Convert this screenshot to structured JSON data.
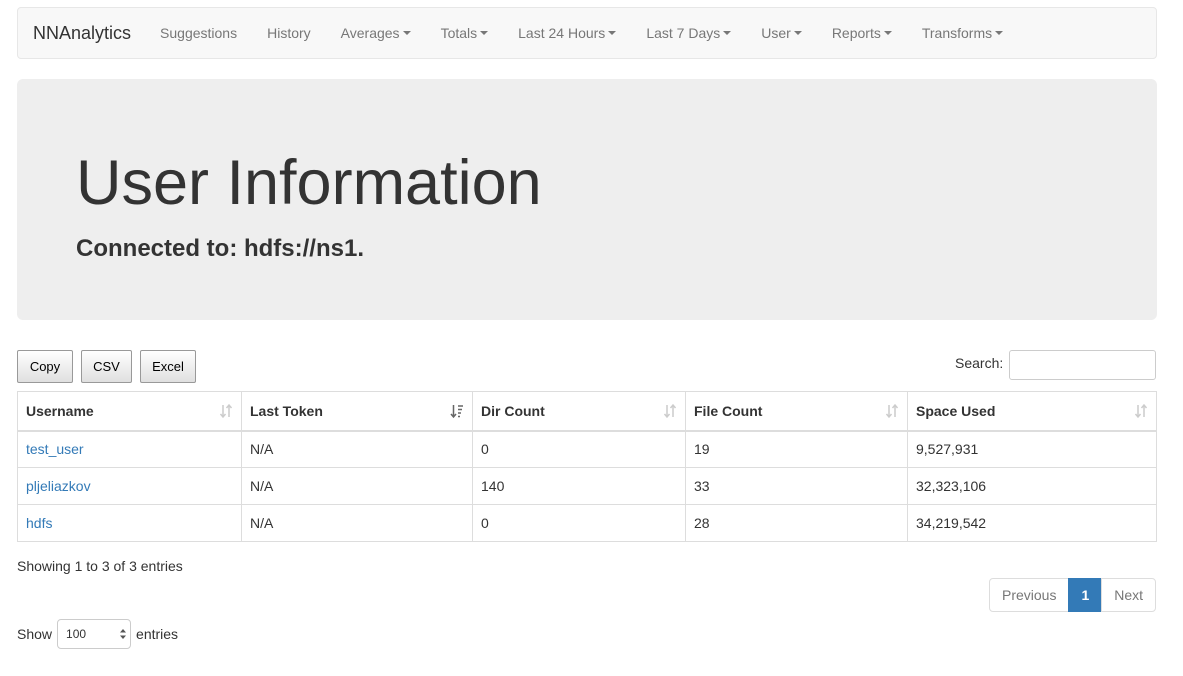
{
  "navbar": {
    "brand": "NNAnalytics",
    "items": [
      {
        "label": "Suggestions",
        "dropdown": false
      },
      {
        "label": "History",
        "dropdown": false
      },
      {
        "label": "Averages",
        "dropdown": true
      },
      {
        "label": "Totals",
        "dropdown": true
      },
      {
        "label": "Last 24 Hours",
        "dropdown": true
      },
      {
        "label": "Last 7 Days",
        "dropdown": true
      },
      {
        "label": "User",
        "dropdown": true
      },
      {
        "label": "Reports",
        "dropdown": true
      },
      {
        "label": "Transforms",
        "dropdown": true
      }
    ]
  },
  "header": {
    "title": "User Information",
    "subtitle": "Connected to: hdfs://ns1."
  },
  "toolbar": {
    "copy_label": "Copy",
    "csv_label": "CSV",
    "excel_label": "Excel",
    "search_label": "Search:",
    "search_value": ""
  },
  "table": {
    "columns": [
      "Username",
      "Last Token",
      "Dir Count",
      "File Count",
      "Space Used"
    ],
    "sorted_column": "Last Token",
    "rows": [
      [
        "test_user",
        "N/A",
        "0",
        "19",
        "9,527,931"
      ],
      [
        "pljeliazkov",
        "N/A",
        "140",
        "33",
        "32,323,106"
      ],
      [
        "hdfs",
        "N/A",
        "0",
        "28",
        "34,219,542"
      ]
    ]
  },
  "footer": {
    "info": "Showing 1 to 3 of 3 entries",
    "pagination": {
      "previous": "Previous",
      "current": "1",
      "next": "Next"
    },
    "length": {
      "show": "Show",
      "value": "100",
      "entries": "entries"
    }
  },
  "colors": {
    "link": "#337ab7",
    "active_page": "#337ab7",
    "navbar_bg": "#f8f8f8",
    "jumbotron_bg": "#eeeeee"
  }
}
